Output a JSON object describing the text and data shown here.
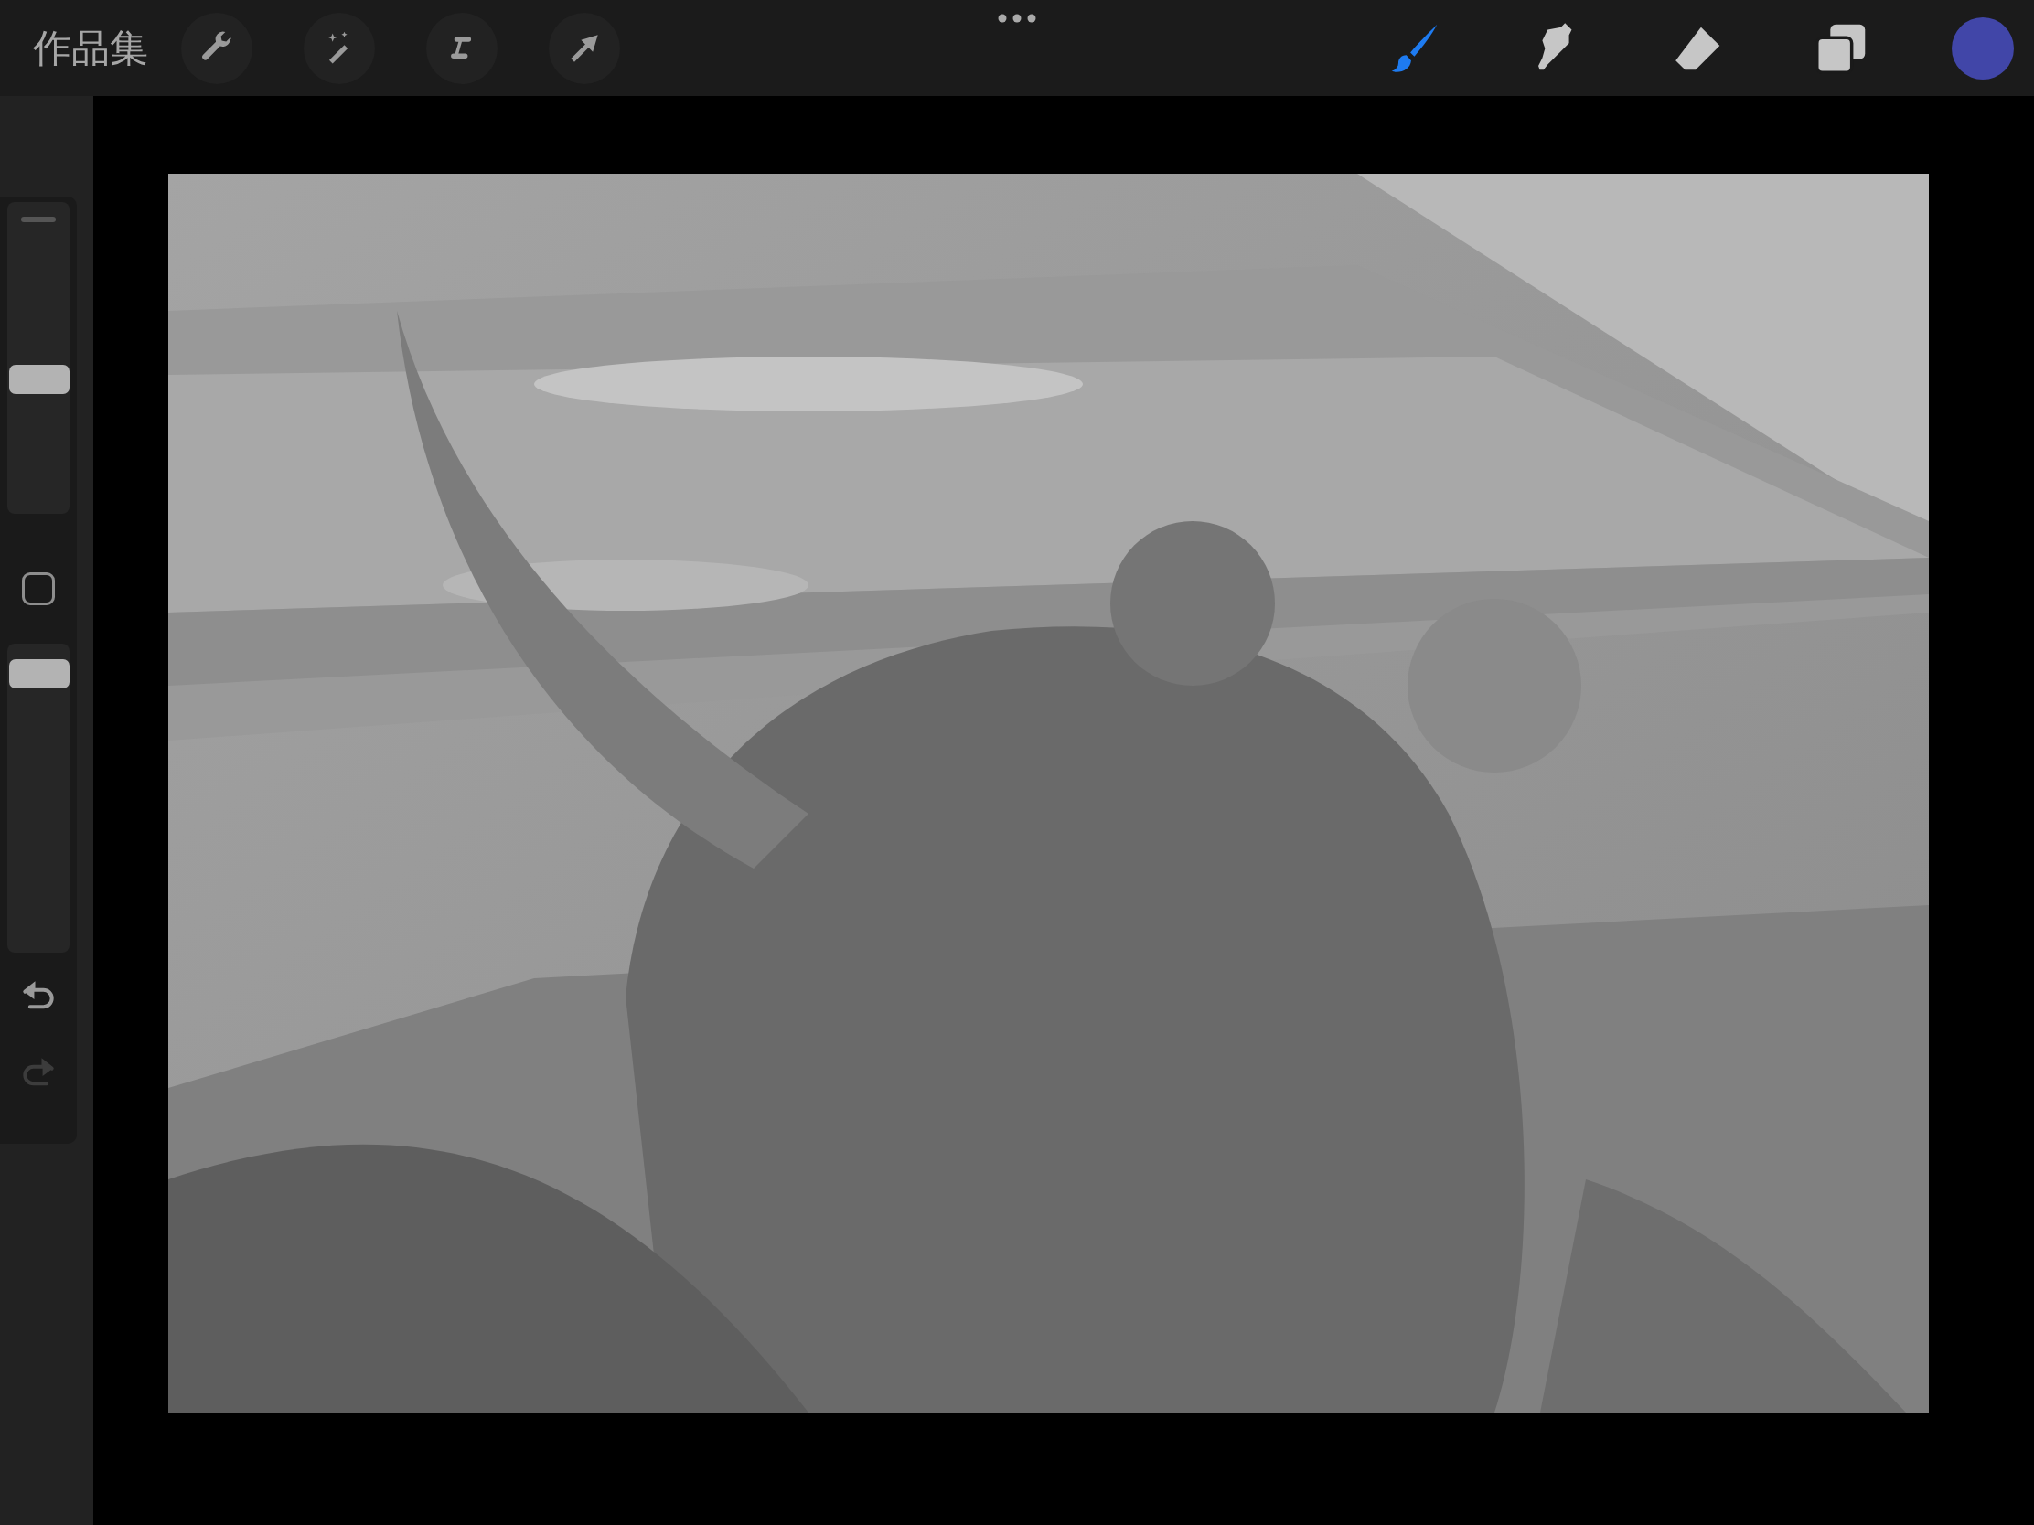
{
  "top_bar": {
    "gallery_link": "作品集",
    "left_tools": [
      {
        "kind": "actions"
      },
      {
        "kind": "adjustments"
      },
      {
        "kind": "selection"
      },
      {
        "kind": "transform"
      }
    ],
    "right_tools": [
      {
        "kind": "brush",
        "selected": true
      },
      {
        "kind": "smudge",
        "selected": false
      },
      {
        "kind": "eraser",
        "selected": false
      },
      {
        "kind": "layers",
        "selected": false
      }
    ],
    "current_color": {
      "color": "#4146a8"
    }
  },
  "sidebar": {
    "brush_size": {
      "level": 0.43
    },
    "opacity": {
      "level": 0.95
    },
    "undo": {
      "disabled": false
    },
    "redo": {
      "disabled": true
    }
  }
}
